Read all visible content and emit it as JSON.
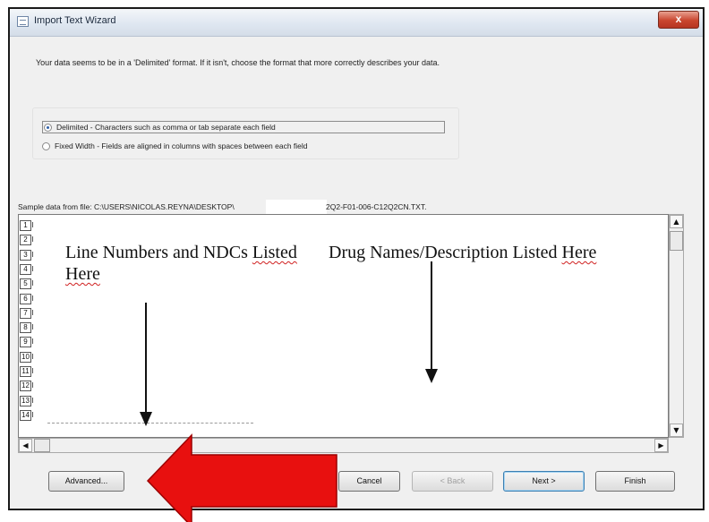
{
  "window": {
    "title": "Import Text Wizard",
    "close_glyph": "x"
  },
  "intro_text": "Your data seems to be in a 'Delimited' format. If it isn't, choose the format that more correctly describes your data.",
  "format_options": [
    {
      "label": "Delimited - Characters such as comma or tab separate each field",
      "selected": true
    },
    {
      "label": "Fixed Width - Fields are aligned in columns with spaces between each field",
      "selected": false
    }
  ],
  "sample": {
    "label": "Sample data from file: C:\\USERS\\NICOLAS.REYNA\\DESKTOP\\",
    "file_tail": "2Q2-F01-006-C12Q2CN.TXT.",
    "line_numbers": [
      "1",
      "2",
      "3",
      "4",
      "5",
      "6",
      "7",
      "8",
      "9",
      "10",
      "11",
      "12",
      "13",
      "14"
    ]
  },
  "annotations": {
    "left_text": "Line Numbers and NDCs Listed Here",
    "right_text": "Drug Names/Description Listed Here",
    "arrow_color": "#e8100f"
  },
  "scroll": {
    "up": "▲",
    "down": "▼",
    "left": "◀",
    "right": "▶"
  },
  "buttons": {
    "advanced": "Advanced...",
    "cancel": "Cancel",
    "back": "< Back",
    "next": "Next >",
    "finish": "Finish"
  }
}
